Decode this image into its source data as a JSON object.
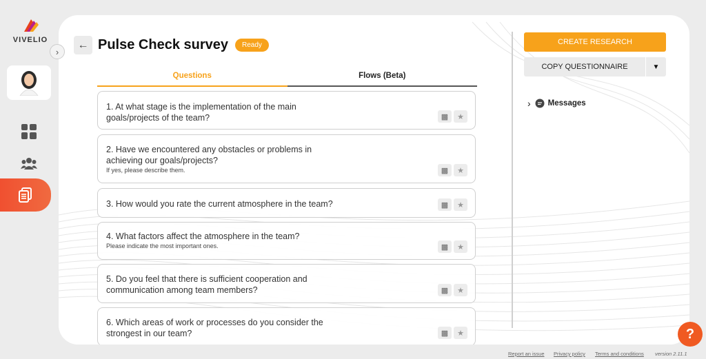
{
  "brand": {
    "name": "VIVELIO"
  },
  "header": {
    "title": "Pulse Check survey",
    "status": "Ready"
  },
  "tabs": [
    {
      "label": "Questions"
    },
    {
      "label": "Flows (Beta)"
    }
  ],
  "questions": [
    {
      "text": "1. At what stage is the implementation of the main goals/projects of the team?",
      "sub": ""
    },
    {
      "text": "2. Have we encountered any obstacles or problems in achieving our goals/projects?",
      "sub": "If yes, please describe them."
    },
    {
      "text": "3. How would you rate the current atmosphere in the team?",
      "sub": ""
    },
    {
      "text": "4. What factors affect the atmosphere in the team?",
      "sub": "Please indicate the most important ones."
    },
    {
      "text": "5. Do you feel that there is sufficient cooperation and communication among team members?",
      "sub": ""
    },
    {
      "text": "6. Which areas of work or processes do you consider the strongest in our team?",
      "sub": ""
    }
  ],
  "actions": {
    "create": "CREATE RESEARCH",
    "copy": "COPY QUESTIONNAIRE"
  },
  "messages": {
    "label": "Messages"
  },
  "footer": {
    "report": "Report an issue",
    "privacy": "Privacy policy",
    "terms": "Terms and conditions",
    "version": "version 2.11.1"
  },
  "help": {
    "label": "?"
  },
  "colors": {
    "accent": "#f7a21b",
    "active_nav": "#f05a30",
    "help": "#f05a22"
  },
  "icons": {
    "back": "arrow-left-icon",
    "collapse": "chevron-right-icon",
    "comment": "comment-icon",
    "star": "star-icon",
    "caret": "caret-down-icon",
    "dashboard": "grid-icon",
    "team": "users-icon",
    "surveys": "documents-icon"
  }
}
